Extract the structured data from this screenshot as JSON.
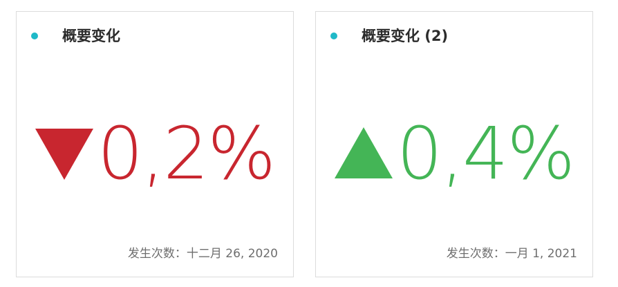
{
  "colors": {
    "dot": "#1fb9c8",
    "down": "#c8262f",
    "up": "#44b556",
    "title": "#2c2c2c",
    "footer": "#6e6e6e",
    "border": "#dcdcdc"
  },
  "cards": [
    {
      "title": "概要变化",
      "direction": "down",
      "arrow_icon": "triangle-down-icon",
      "value": "0,2%",
      "footer": "发生次数：十二月 26, 2020"
    },
    {
      "title": "概要变化 (2)",
      "direction": "up",
      "arrow_icon": "triangle-up-icon",
      "value": "0,4%",
      "footer": "发生次数：一月 1, 2021"
    }
  ]
}
